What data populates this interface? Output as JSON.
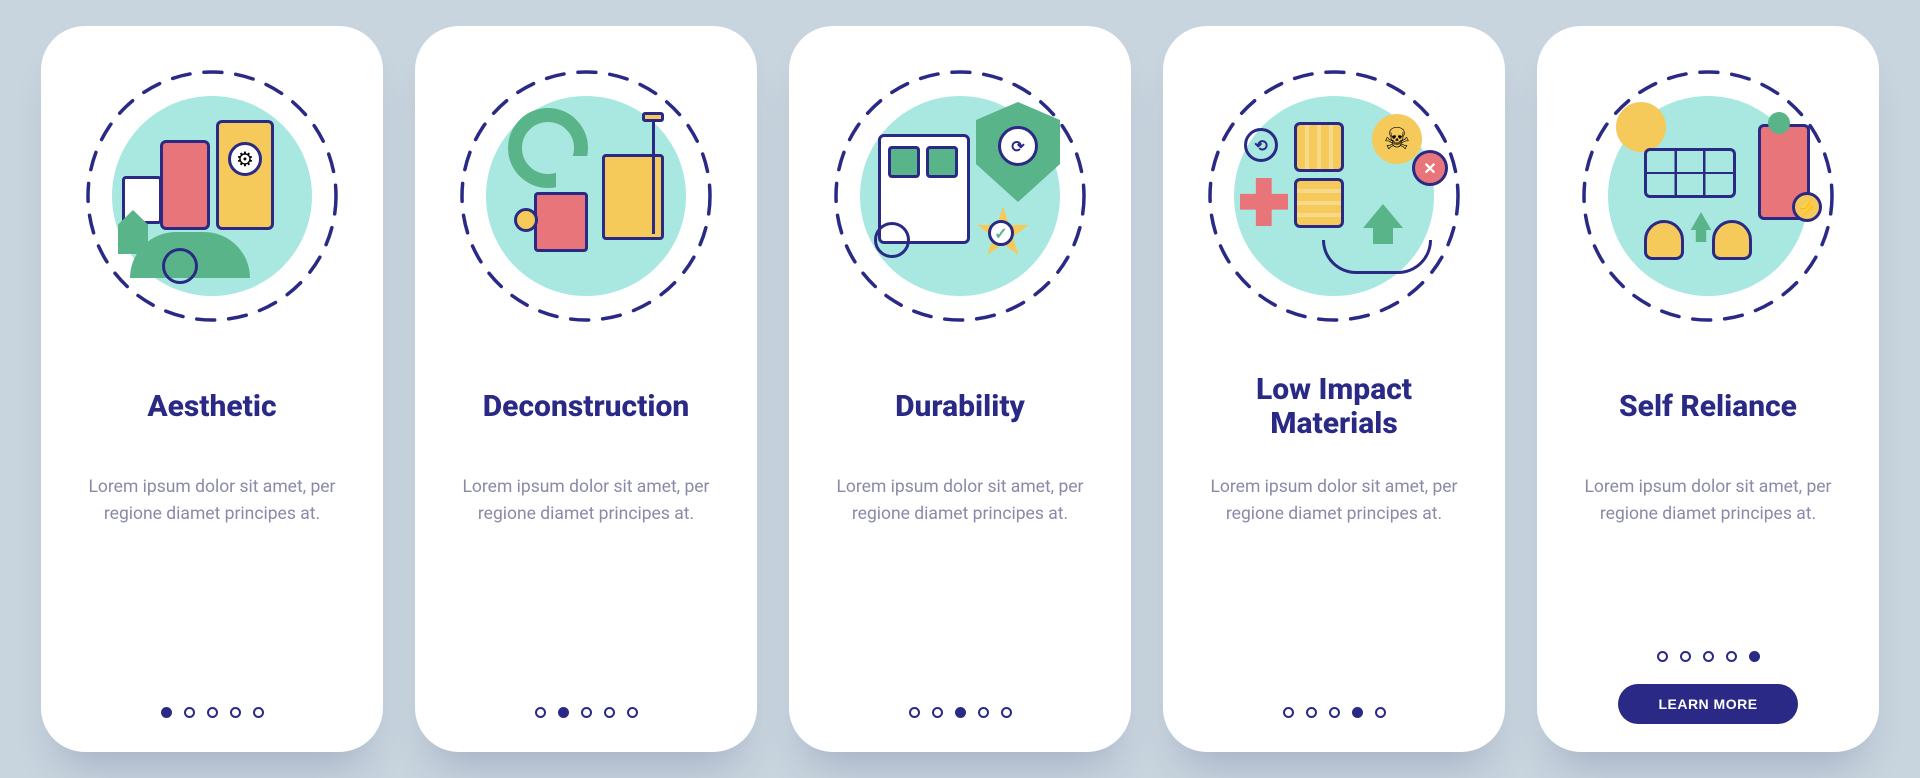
{
  "common": {
    "description": "Lorem ipsum dolor sit amet, per regione diamet principes at.",
    "totalSlides": 5,
    "cta_label": "LEARN MORE"
  },
  "cards": [
    {
      "icon": "city-aesthetic-icon",
      "title": "Aesthetic",
      "activeDot": 0,
      "cta": false
    },
    {
      "icon": "deconstruction-icon",
      "title": "Deconstruction",
      "activeDot": 1,
      "cta": false
    },
    {
      "icon": "durability-shield-icon",
      "title": "Durability",
      "activeDot": 2,
      "cta": false
    },
    {
      "icon": "low-impact-materials-icon",
      "title": "Low Impact Materials",
      "activeDot": 3,
      "cta": false
    },
    {
      "icon": "self-reliance-solar-icon",
      "title": "Self Reliance",
      "activeDot": 4,
      "cta": true
    }
  ],
  "colors": {
    "background": "#c8d4de",
    "card": "#ffffff",
    "title": "#2a2a86",
    "body_text": "#8a8aa8",
    "accent": "#2a2a86",
    "mint": "#a8e8e0",
    "yellow": "#f5c95a",
    "coral": "#e8757a",
    "green": "#5ab489"
  }
}
